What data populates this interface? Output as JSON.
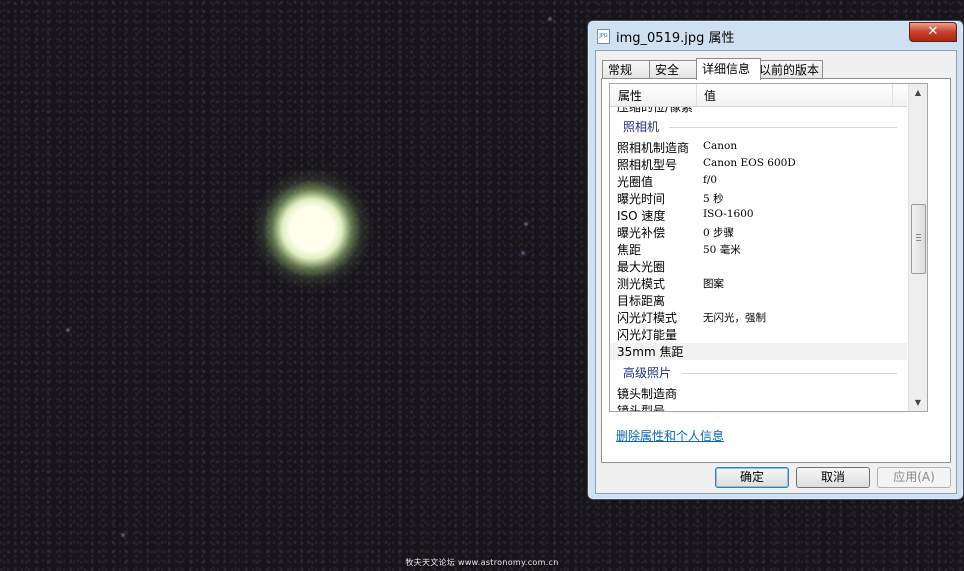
{
  "background": {
    "watermark": "牧夫天文论坛 www.astronomy.com.cn"
  },
  "dialog": {
    "title": "img_0519.jpg 属性",
    "close_symbol": "✕",
    "file_icon": "jpg-file-icon",
    "tabs": [
      {
        "label": "常规",
        "active": false
      },
      {
        "label": "安全",
        "active": false
      },
      {
        "label": "详细信息",
        "active": true
      },
      {
        "label": "以前的版本",
        "active": false
      }
    ],
    "list": {
      "columns": [
        "属性",
        "值"
      ],
      "partial_top_row": "压缩的位/像素",
      "groups": [
        {
          "title": "照相机"
        },
        {
          "title": "高级照片"
        }
      ],
      "rows": [
        {
          "property": "照相机制造商",
          "value": "Canon"
        },
        {
          "property": "照相机型号",
          "value": "Canon EOS 600D"
        },
        {
          "property": "光圈值",
          "value": "f/0"
        },
        {
          "property": "曝光时间",
          "value": "5 秒"
        },
        {
          "property": "ISO 速度",
          "value": "ISO-1600"
        },
        {
          "property": "曝光补偿",
          "value": "0 步骤"
        },
        {
          "property": "焦距",
          "value": "50 毫米"
        },
        {
          "property": "最大光圈",
          "value": ""
        },
        {
          "property": "测光模式",
          "value": "图案"
        },
        {
          "property": "目标距离",
          "value": ""
        },
        {
          "property": "闪光灯模式",
          "value": "无闪光，强制"
        },
        {
          "property": "闪光灯能量",
          "value": ""
        },
        {
          "property": "35mm 焦距",
          "value": ""
        }
      ],
      "advanced_rows": [
        {
          "property": "镜头制造商",
          "value": ""
        },
        {
          "property": "镜头型号",
          "value": ""
        }
      ],
      "scroll_up": "▲",
      "scroll_down": "▼"
    },
    "remove_link": "删除属性和个人信息",
    "buttons": {
      "ok": "确定",
      "cancel": "取消",
      "apply": "应用(A)"
    }
  }
}
